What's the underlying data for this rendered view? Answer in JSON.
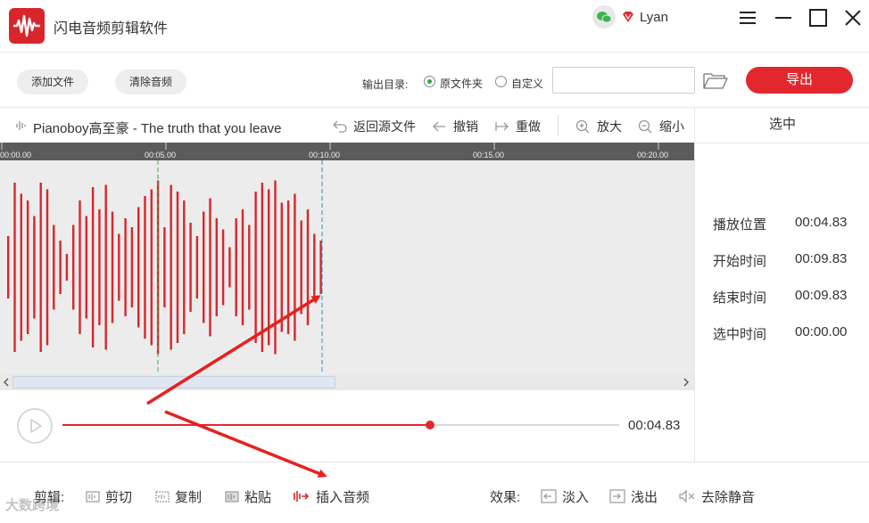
{
  "app": {
    "title": "闪电音频剪辑软件",
    "username": "Lyan"
  },
  "toolbar": {
    "add_file": "添加文件",
    "clear_audio": "清除音频",
    "output_label": "输出目录:",
    "radio_source": "原文件夹",
    "radio_custom": "自定义",
    "export": "导出"
  },
  "editor": {
    "track_title": "Pianoboy高至豪 - The truth that you leave",
    "tools": {
      "back": "返回源文件",
      "undo": "撤销",
      "redo": "重做",
      "zoom_in": "放大",
      "zoom_out": "缩小"
    },
    "ruler_ticks": [
      "00:00.00",
      "00:05.00",
      "00:10.00",
      "00:15.00",
      "00:20.00"
    ]
  },
  "panel": {
    "header": "选中",
    "rows": [
      {
        "label": "播放位置",
        "value": "00:04.83"
      },
      {
        "label": "开始时间",
        "value": "00:09.83"
      },
      {
        "label": "结束时间",
        "value": "00:09.83"
      },
      {
        "label": "选中时间",
        "value": "00:00.00"
      }
    ]
  },
  "player": {
    "time": "00:04.83",
    "progress": 0.66
  },
  "bottom": {
    "edit_label": "剪辑:",
    "cut": "剪切",
    "copy": "复制",
    "paste": "粘贴",
    "insert_audio": "插入音频",
    "effect_label": "效果:",
    "fade_in": "淡入",
    "fade_out": "浅出",
    "remove_silence": "去除静音"
  },
  "watermark": "大数跨境",
  "colors": {
    "accent": "#e2282e",
    "wave": "#d8262c",
    "marker_green": "#3cb34a",
    "marker_blue": "#2a8fd6"
  }
}
